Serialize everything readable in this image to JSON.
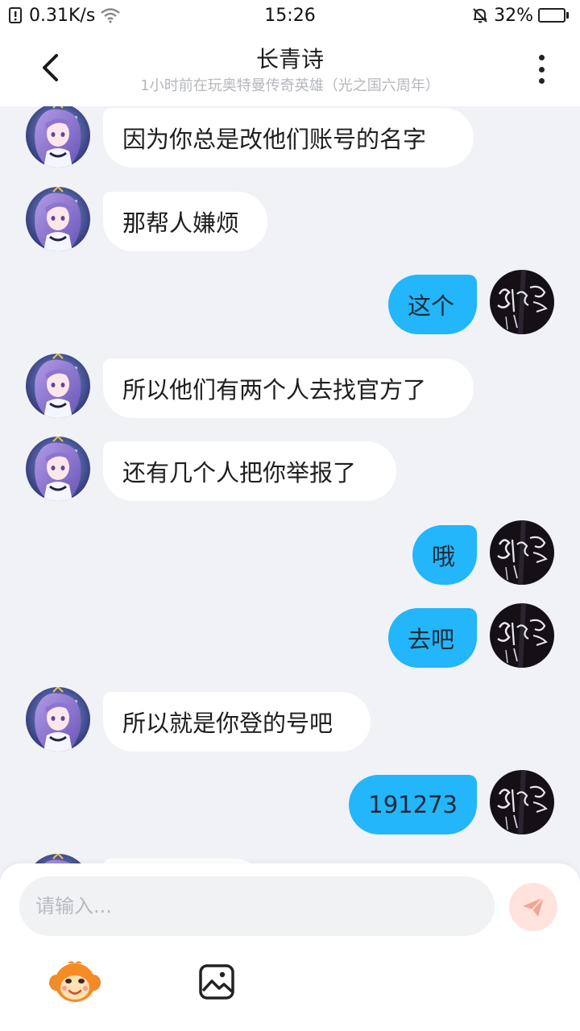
{
  "status_bar": {
    "net_speed": "0.31K/s",
    "time": "15:26",
    "battery_percent": "32%",
    "battery_level": 0.32
  },
  "header": {
    "title": "长青诗",
    "subtitle": "1小时前在玩奥特曼传奇英雄（光之国六周年）"
  },
  "messages": [
    {
      "side": "left",
      "text": "因为你总是改他们账号的名字"
    },
    {
      "side": "left",
      "text": "那帮人嫌烦"
    },
    {
      "side": "right",
      "text": "这个"
    },
    {
      "side": "left",
      "text": "所以他们有两个人去找官方了"
    },
    {
      "side": "left",
      "text": "还有几个人把你举报了"
    },
    {
      "side": "right",
      "text": "哦"
    },
    {
      "side": "right",
      "text": "去吧"
    },
    {
      "side": "left",
      "text": "所以就是你登的号吧"
    },
    {
      "side": "right",
      "text": "191273"
    },
    {
      "side": "left",
      "text": ""
    }
  ],
  "input": {
    "placeholder": "请输入..."
  },
  "icons": {
    "back": "chevron-left-icon",
    "more": "more-vertical-icon",
    "send": "send-icon",
    "emoji": "monkey-emoji-icon",
    "image": "image-icon"
  },
  "colors": {
    "outgoing_bubble": "#23b6fb",
    "incoming_bubble": "#ffffff",
    "chat_background": "#f1f2f6",
    "send_button": "#ffe3dc",
    "send_icon": "#f2a594"
  }
}
